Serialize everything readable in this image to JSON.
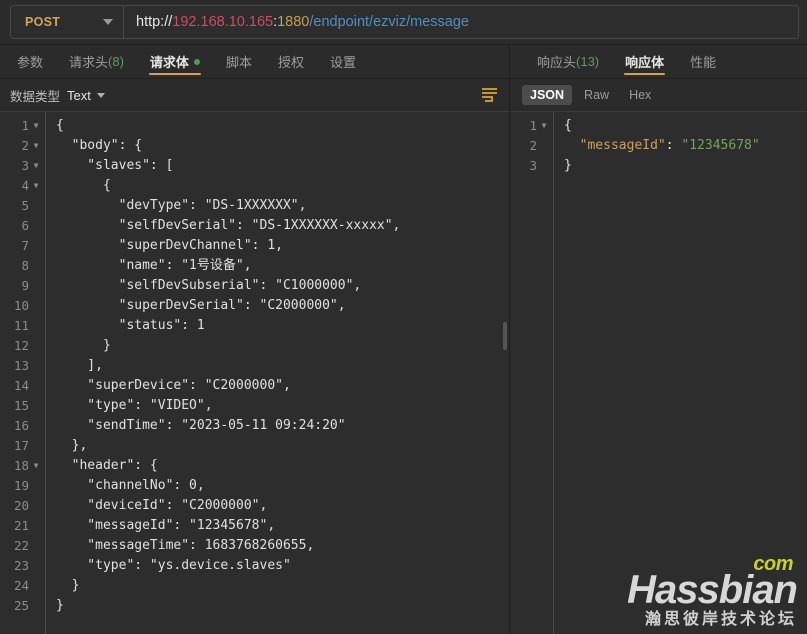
{
  "request_bar": {
    "method": "POST",
    "method_caret_icon": "chevron-down-icon",
    "url_scheme": "http://",
    "url_host": "192.168.10.165",
    "url_colon": ":",
    "url_port": "1880",
    "url_path": "/endpoint/ezviz/message"
  },
  "request_tabs": [
    {
      "label": "参数",
      "count": "",
      "active": false,
      "modified": false
    },
    {
      "label": "请求头",
      "count": "(8)",
      "active": false,
      "modified": false
    },
    {
      "label": "请求体",
      "count": "",
      "active": true,
      "modified": true
    },
    {
      "label": "脚本",
      "count": "",
      "active": false,
      "modified": false
    },
    {
      "label": "授权",
      "count": "",
      "active": false,
      "modified": false
    },
    {
      "label": "设置",
      "count": "",
      "active": false,
      "modified": false
    }
  ],
  "request_subbar": {
    "datatype_label": "数据类型",
    "datatype_value": "Text",
    "datatype_caret_icon": "chevron-down-icon",
    "format_icon": "format-code-icon"
  },
  "response_tabs": [
    {
      "label": "响应头",
      "count": "(13)",
      "active": false
    },
    {
      "label": "响应体",
      "count": "",
      "active": true
    },
    {
      "label": "性能",
      "count": "",
      "active": false
    }
  ],
  "response_view_modes": [
    {
      "label": "JSON",
      "active": true
    },
    {
      "label": "Raw",
      "active": false
    },
    {
      "label": "Hex",
      "active": false
    }
  ],
  "request_body": {
    "lines": [
      {
        "n": 1,
        "foldable": true,
        "text": "{"
      },
      {
        "n": 2,
        "foldable": true,
        "text": "  \"body\": {"
      },
      {
        "n": 3,
        "foldable": true,
        "text": "    \"slaves\": ["
      },
      {
        "n": 4,
        "foldable": true,
        "text": "      {"
      },
      {
        "n": 5,
        "foldable": false,
        "text": "        \"devType\": \"DS-1XXXXXX\","
      },
      {
        "n": 6,
        "foldable": false,
        "text": "        \"selfDevSerial\": \"DS-1XXXXXX-xxxxx\","
      },
      {
        "n": 7,
        "foldable": false,
        "text": "        \"superDevChannel\": 1,"
      },
      {
        "n": 8,
        "foldable": false,
        "text": "        \"name\": \"1号设备\","
      },
      {
        "n": 9,
        "foldable": false,
        "text": "        \"selfDevSubserial\": \"C1000000\","
      },
      {
        "n": 10,
        "foldable": false,
        "text": "        \"superDevSerial\": \"C2000000\","
      },
      {
        "n": 11,
        "foldable": false,
        "text": "        \"status\": 1"
      },
      {
        "n": 12,
        "foldable": false,
        "text": "      }"
      },
      {
        "n": 13,
        "foldable": false,
        "text": "    ],"
      },
      {
        "n": 14,
        "foldable": false,
        "text": "    \"superDevice\": \"C2000000\","
      },
      {
        "n": 15,
        "foldable": false,
        "text": "    \"type\": \"VIDEO\","
      },
      {
        "n": 16,
        "foldable": false,
        "text": "    \"sendTime\": \"2023-05-11 09:24:20\""
      },
      {
        "n": 17,
        "foldable": false,
        "text": "  },"
      },
      {
        "n": 18,
        "foldable": true,
        "text": "  \"header\": {"
      },
      {
        "n": 19,
        "foldable": false,
        "text": "    \"channelNo\": 0,"
      },
      {
        "n": 20,
        "foldable": false,
        "text": "    \"deviceId\": \"C2000000\","
      },
      {
        "n": 21,
        "foldable": false,
        "text": "    \"messageId\": \"12345678\","
      },
      {
        "n": 22,
        "foldable": false,
        "text": "    \"messageTime\": 1683768260655,"
      },
      {
        "n": 23,
        "foldable": false,
        "text": "    \"type\": \"ys.device.slaves\""
      },
      {
        "n": 24,
        "foldable": false,
        "text": "  }"
      },
      {
        "n": 25,
        "foldable": false,
        "text": "}"
      }
    ]
  },
  "response_body": {
    "lines": [
      {
        "n": 1,
        "foldable": true,
        "indent": "",
        "key": "",
        "sep": "",
        "value": "{",
        "plain": "{"
      },
      {
        "n": 2,
        "foldable": false,
        "indent": "  ",
        "key": "\"messageId\"",
        "sep": ": ",
        "value": "\"12345678\"",
        "plain": ""
      },
      {
        "n": 3,
        "foldable": false,
        "indent": "",
        "key": "",
        "sep": "",
        "value": "",
        "plain": "}"
      }
    ]
  },
  "watermark": {
    "com": "com",
    "main": "Hassbian",
    "subtitle": "瀚思彼岸技术论坛"
  },
  "colors": {
    "accent": "#d8a044",
    "method": "#d9a44a",
    "url_host": "#d14b63",
    "url_port": "#c0a050",
    "url_path": "#4c90c4",
    "count_green": "#5f9c5f",
    "modified_dot": "#4f9a4f",
    "json_key": "#c7a25e",
    "json_string": "#7ba05b",
    "background": "#2b2b2b",
    "editor_bg": "#2d2d2d"
  }
}
